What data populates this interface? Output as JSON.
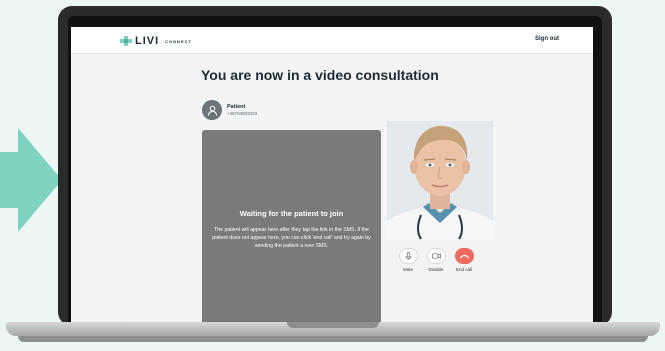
{
  "header": {
    "logo_text": "LIVI",
    "logo_sub": "CONNECT",
    "signout_label": "Sign out"
  },
  "main": {
    "title": "You are now in a video consultation"
  },
  "patient": {
    "name": "Patient",
    "phone": "+46704833333"
  },
  "waiting": {
    "title": "Waiting for the patient to join",
    "text": "The patient will appear here after they tap the link in the SMS. If the patient does not appear here, you can click 'end call' and try again by sending the patient a new SMS."
  },
  "controls": [
    {
      "label": "Mute",
      "icon": "microphone-icon"
    },
    {
      "label": "Disable",
      "icon": "camera-icon"
    },
    {
      "label": "End call",
      "icon": "phone-hangup-icon"
    }
  ],
  "colors": {
    "accent": "#7fd1c0",
    "end_call": "#f06a5f",
    "panel": "#7a7a7a",
    "text_dark": "#1c2b33"
  }
}
